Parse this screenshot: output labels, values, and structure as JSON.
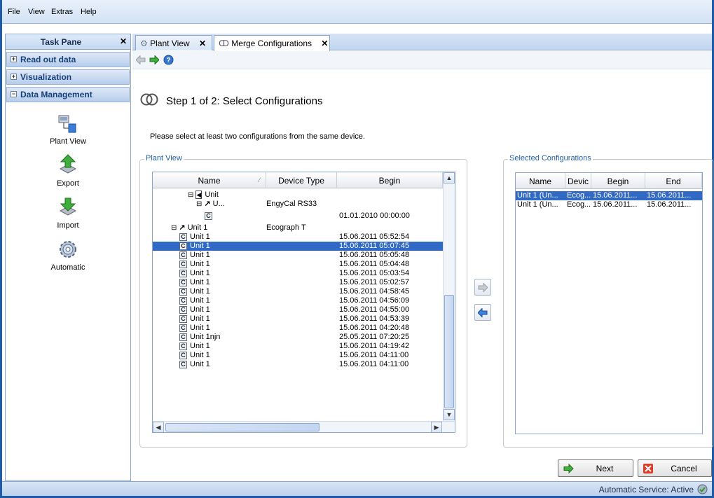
{
  "menu": [
    "File",
    "View",
    "Extras",
    "Help"
  ],
  "task_pane": {
    "title": "Task Pane",
    "close": "✕",
    "sections": [
      {
        "label": "Read out data",
        "state": "+"
      },
      {
        "label": "Visualization",
        "state": "+"
      },
      {
        "label": "Data Management",
        "state": "−"
      }
    ],
    "items": [
      "Plant View",
      "Export",
      "Import",
      "Automatic"
    ]
  },
  "tabs": [
    {
      "label": "Plant View",
      "close": "✕",
      "icon": "plant-view-icon"
    },
    {
      "label": "Merge Configurations",
      "close": "✕",
      "icon": "merge-icon"
    }
  ],
  "step_title": "Step 1 of 2: Select Configurations",
  "instruction": "Please select at least two configurations from the same device.",
  "plant_view": {
    "label": "Plant View",
    "headers": [
      "Name",
      "Device Type",
      "Begin"
    ],
    "sort_glyph": "∕",
    "rows": [
      {
        "indent": 3,
        "toggle": "⊟",
        "icon": "flag",
        "name": "Unit",
        "type": "",
        "begin": ""
      },
      {
        "indent": 4,
        "toggle": "⊟",
        "icon": "device",
        "name": "U...",
        "type": "EngyCal RS33",
        "begin": ""
      },
      {
        "indent": 5,
        "toggle": "",
        "icon": "C",
        "name": "",
        "type": "",
        "begin": "01.01.2010 00:00:00"
      },
      {
        "indent": 1,
        "toggle": "⊟",
        "icon": "device",
        "name": "Unit 1",
        "type": "Ecograph T",
        "begin": ""
      },
      {
        "indent": 2,
        "toggle": "",
        "icon": "C",
        "name": "Unit 1",
        "type": "",
        "begin": "15.06.2011 05:52:54"
      },
      {
        "indent": 2,
        "toggle": "",
        "icon": "C",
        "name": "Unit 1",
        "type": "",
        "begin": "15.06.2011 05:07:45",
        "selected": true
      },
      {
        "indent": 2,
        "toggle": "",
        "icon": "C",
        "name": "Unit 1",
        "type": "",
        "begin": "15.06.2011 05:05:48"
      },
      {
        "indent": 2,
        "toggle": "",
        "icon": "C",
        "name": "Unit 1",
        "type": "",
        "begin": "15.06.2011 05:04:48"
      },
      {
        "indent": 2,
        "toggle": "",
        "icon": "C",
        "name": "Unit 1",
        "type": "",
        "begin": "15.06.2011 05:03:54"
      },
      {
        "indent": 2,
        "toggle": "",
        "icon": "C",
        "name": "Unit 1",
        "type": "",
        "begin": "15.06.2011 05:02:57"
      },
      {
        "indent": 2,
        "toggle": "",
        "icon": "C",
        "name": "Unit 1",
        "type": "",
        "begin": "15.06.2011 04:58:45"
      },
      {
        "indent": 2,
        "toggle": "",
        "icon": "C",
        "name": "Unit 1",
        "type": "",
        "begin": "15.06.2011 04:56:09"
      },
      {
        "indent": 2,
        "toggle": "",
        "icon": "C",
        "name": "Unit 1",
        "type": "",
        "begin": "15.06.2011 04:55:00"
      },
      {
        "indent": 2,
        "toggle": "",
        "icon": "C",
        "name": "Unit 1",
        "type": "",
        "begin": "15.06.2011 04:53:39"
      },
      {
        "indent": 2,
        "toggle": "",
        "icon": "C",
        "name": "Unit 1",
        "type": "",
        "begin": "15.06.2011 04:20:48"
      },
      {
        "indent": 2,
        "toggle": "",
        "icon": "C",
        "name": "Unit 1njn",
        "type": "",
        "begin": "25.05.2011 07:20:25"
      },
      {
        "indent": 2,
        "toggle": "",
        "icon": "C",
        "name": "Unit 1",
        "type": "",
        "begin": "15.06.2011 04:19:42"
      },
      {
        "indent": 2,
        "toggle": "",
        "icon": "C",
        "name": "Unit 1",
        "type": "",
        "begin": "15.06.2011 04:11:00"
      },
      {
        "indent": 2,
        "toggle": "",
        "icon": "C",
        "name": "Unit 1",
        "type": "",
        "begin": "15.06.2011 04:11:00"
      }
    ]
  },
  "selected_configs": {
    "label": "Selected Configurations",
    "headers": [
      "Name",
      "Devic",
      "Begin",
      "End"
    ],
    "rows": [
      {
        "name": "Unit 1 (Un...",
        "device": "Ecog...",
        "begin": "15.06.2011...",
        "end": "15.06.2011...",
        "selected": true
      },
      {
        "name": "Unit 1 (Un...",
        "device": "Ecog...",
        "begin": "15.06.2011...",
        "end": "15.06.2011..."
      }
    ]
  },
  "buttons": {
    "next": "Next",
    "cancel": "Cancel"
  },
  "status": "Automatic Service: Active",
  "colors": {
    "accent": "#316ac5",
    "frame": "#1f5ba8",
    "group_label": "#1f5fa8"
  }
}
